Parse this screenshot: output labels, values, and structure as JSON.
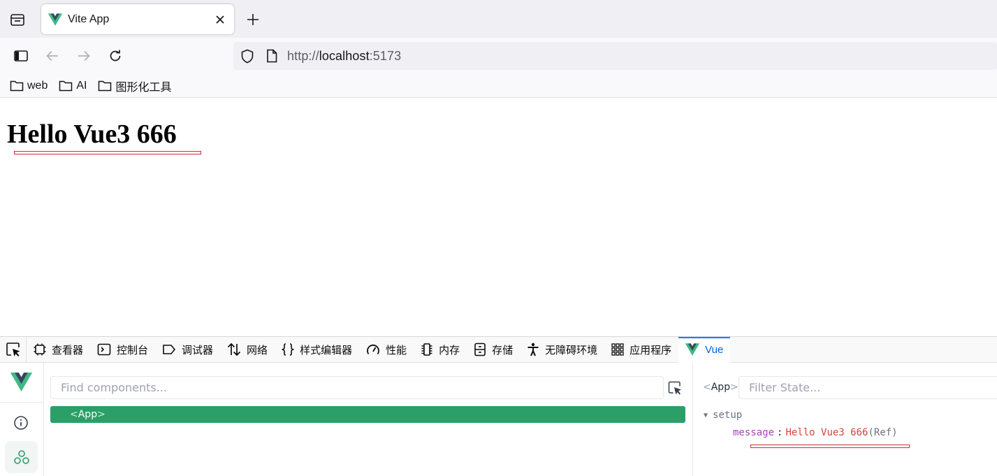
{
  "browser": {
    "tab": {
      "title": "Vite App"
    },
    "new_tab_symbol": "+",
    "url": {
      "scheme": "http://",
      "host": "localhost",
      "port": ":5173"
    },
    "bookmarks": [
      "web",
      "AI",
      "图形化工具"
    ]
  },
  "page": {
    "heading": "Hello Vue3 666"
  },
  "devtools": {
    "tabs": [
      "查看器",
      "控制台",
      "调试器",
      "网络",
      "样式编辑器",
      "性能",
      "内存",
      "存储",
      "无障碍环境",
      "应用程序",
      "Vue"
    ],
    "active_tab": "Vue",
    "vue": {
      "find_placeholder": "Find components...",
      "tree": {
        "open": "<",
        "name": "App",
        "close": ">"
      },
      "state": {
        "component": {
          "open": "<",
          "name": "App",
          "close": ">"
        },
        "filter_placeholder": "Filter State...",
        "section": "setup",
        "key": "message",
        "colon": ":",
        "value": "Hello Vue3 666",
        "type": "(Ref)"
      }
    }
  },
  "colors": {
    "vue_green": "#41b883",
    "vue_dark": "#35495e",
    "tree_selected": "#2aa068",
    "active_tab_blue": "#0060df",
    "annotation_red": "#c8303a"
  }
}
